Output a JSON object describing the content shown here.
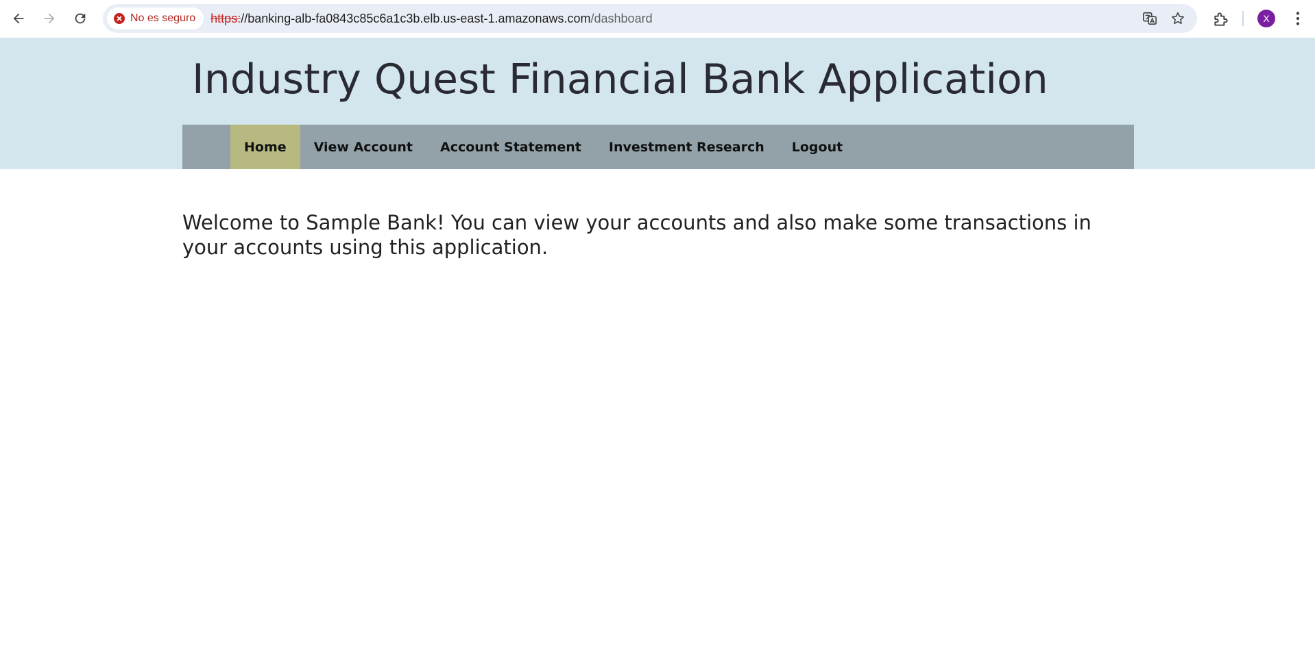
{
  "browser": {
    "security_label": "No es seguro",
    "url_scheme": "https:",
    "url_host": "//banking-alb-fa0843c85c6a1c3b.elb.us-east-1.amazonaws.com",
    "url_path": "/dashboard",
    "profile_initial": "X",
    "icons": [
      "back-icon",
      "forward-icon",
      "reload-icon",
      "translate-icon",
      "bookmark-star-icon",
      "extensions-icon",
      "menu-icon"
    ],
    "colors": {
      "avatar": "#7b1fa2",
      "insecure": "#c5221f"
    }
  },
  "header": {
    "title": "Industry Quest Financial Bank Application",
    "background": "#d3e6ee"
  },
  "nav": {
    "background": "#93a2a9",
    "active_color": "#b7b980",
    "items": [
      {
        "label": "Home",
        "active": true
      },
      {
        "label": "View Account",
        "active": false
      },
      {
        "label": "Account Statement",
        "active": false
      },
      {
        "label": "Investment Research",
        "active": false
      },
      {
        "label": "Logout",
        "active": false
      }
    ]
  },
  "main": {
    "welcome": "Welcome to Sample Bank! You can view your accounts and also make some transactions in your accounts using this application."
  }
}
